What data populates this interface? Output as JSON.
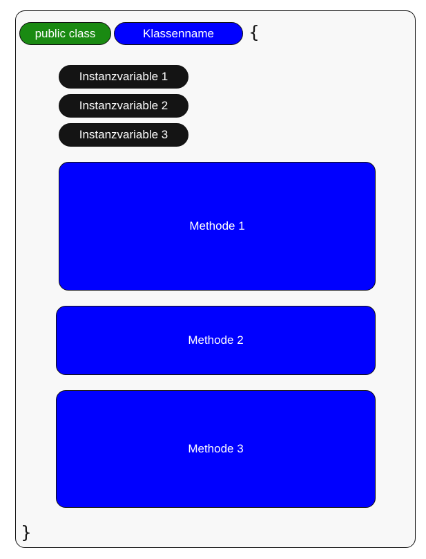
{
  "header": {
    "keyword": "public class",
    "class_name": "Klassenname",
    "open_brace": "{",
    "close_brace": "}"
  },
  "instance_variables": [
    {
      "label": "Instanzvariable 1"
    },
    {
      "label": "Instanzvariable 2"
    },
    {
      "label": "Instanzvariable 3"
    }
  ],
  "methods": [
    {
      "label": "Methode 1"
    },
    {
      "label": "Methode 2"
    },
    {
      "label": "Methode 3"
    }
  ],
  "colors": {
    "keyword_green": "#1a8a12",
    "class_name_blue": "#0000ff",
    "variable_dark": "#141414",
    "method_blue": "#0000ff",
    "frame_background": "#f8f8f8"
  }
}
